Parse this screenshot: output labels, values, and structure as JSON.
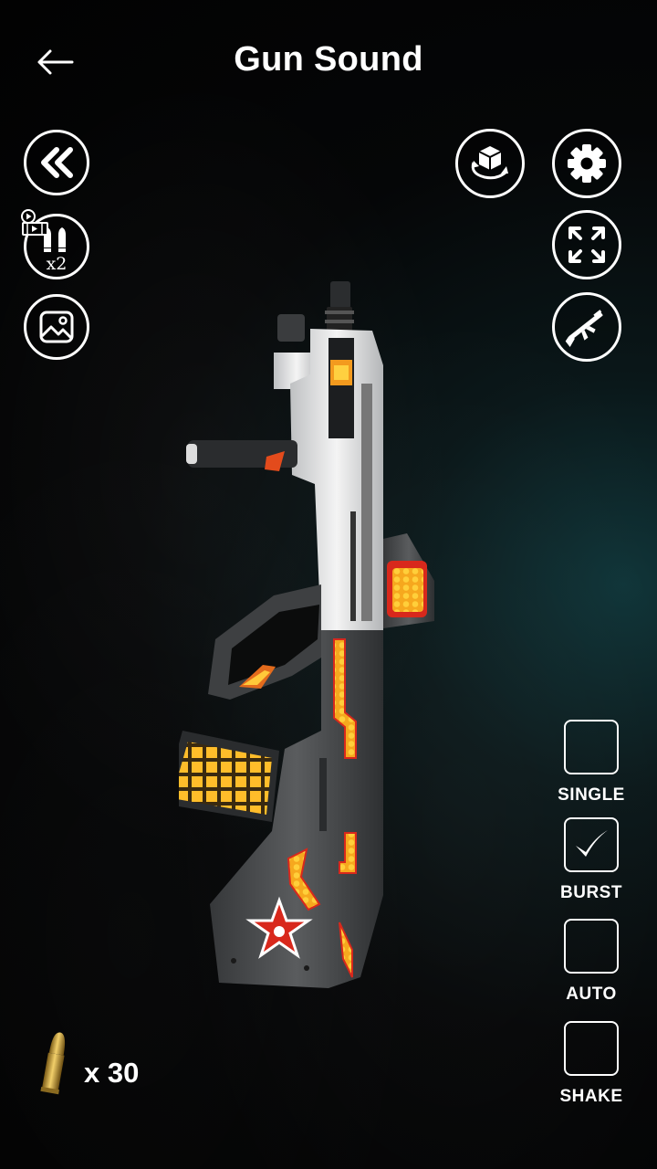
{
  "header": {
    "title": "Gun Sound",
    "back_icon": "arrow-left-icon"
  },
  "left_controls": [
    {
      "name": "previous-button",
      "icon": "double-chevron-left-icon"
    },
    {
      "name": "double-bullets-button",
      "icon": "bullets-icon",
      "text": "x2",
      "badge_icon": "video-ad-icon"
    },
    {
      "name": "background-image-button",
      "icon": "image-icon"
    }
  ],
  "right_controls": [
    {
      "name": "rotate-3d-button",
      "icon": "cube-rotate-icon"
    },
    {
      "name": "settings-button",
      "icon": "gear-icon"
    },
    {
      "name": "fullscreen-button",
      "icon": "expand-arrows-icon"
    },
    {
      "name": "weapon-select-button",
      "icon": "rifle-icon"
    }
  ],
  "modes": [
    {
      "label": "SINGLE",
      "checked": false
    },
    {
      "label": "BURST",
      "checked": true
    },
    {
      "label": "AUTO",
      "checked": false
    },
    {
      "label": "SHAKE",
      "checked": false
    }
  ],
  "ammo": {
    "icon": "bullet-icon",
    "count_text": "x 30"
  },
  "colors": {
    "accent_orange": "#f39a1e",
    "accent_red": "#d8281c",
    "gun_white": "#e8e8e8",
    "gun_gray": "#4a4c4e"
  }
}
